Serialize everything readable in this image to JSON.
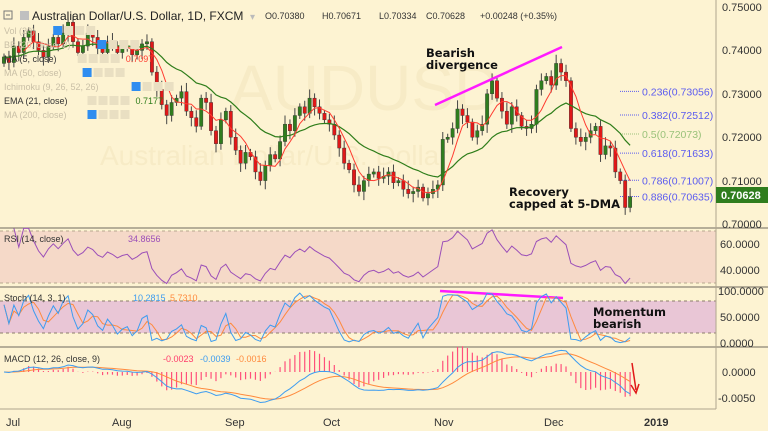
{
  "header": {
    "title": "Australian Dollar/U.S. Dollar, 1D, FXCM",
    "open": "O0.70380",
    "high": "H0.70671",
    "low": "L0.70334",
    "close": "C0.70628",
    "change": "+0.00248 (+0.35%)"
  },
  "watermark": {
    "symbol": "AUDUSD",
    "name": "Australian Dollar/U.S. Dollar"
  },
  "indicators": [
    {
      "label": "Vol (20)",
      "value": ""
    },
    {
      "label": "BB (20, close, 2)",
      "value": ""
    },
    {
      "label": "MA (5, close)",
      "value": "0.7097"
    },
    {
      "label": "MA (50, close)",
      "value": ""
    },
    {
      "label": "Ichimoku (9, 26, 52, 26)",
      "value": ""
    },
    {
      "label": "EMA (21, close)",
      "value": "0.7177"
    },
    {
      "label": "MA (200, close)",
      "value": ""
    }
  ],
  "annotations": {
    "bearish": [
      "Bearish",
      "divergence"
    ],
    "recovery": [
      "Recovery",
      "capped at 5-DMA"
    ],
    "momentum": [
      "Momentum",
      "bearish"
    ]
  },
  "fib_levels": [
    {
      "label": "0.236(0.73056)",
      "price": 0.73056,
      "color": "#5b5bf0"
    },
    {
      "label": "0.382(0.72512)",
      "price": 0.72512,
      "color": "#5b5bf0"
    },
    {
      "label": "0.5(0.72073)",
      "price": 0.72073,
      "color": "#9ac27a"
    },
    {
      "label": "0.618(0.71633)",
      "price": 0.71633,
      "color": "#5b5bf0"
    },
    {
      "label": "0.786(0.71007)",
      "price": 0.71007,
      "color": "#5b5bf0"
    },
    {
      "label": "0.886(0.70635)",
      "price": 0.70635,
      "color": "#5b5bf0"
    }
  ],
  "last_price": "0.70628",
  "panels": {
    "rsi": {
      "label": "RSI (14, close)",
      "value": "34.8656",
      "ticks": [
        "60.0000",
        "40.0000"
      ]
    },
    "stoch": {
      "label": "Stoch (14, 3, 1)",
      "k": "10.2815",
      "d": "5.7310",
      "ticks": [
        "100.0000",
        "50.0000",
        "0.0000"
      ]
    },
    "macd": {
      "label": "MACD (12, 26, close, 9)",
      "hist": "-0.0023",
      "macd": "-0.0039",
      "signal": "-0.0016",
      "ticks": [
        "0.0000",
        "-0.0050"
      ]
    }
  },
  "colors": {
    "bull": "#2f7d1e",
    "bear": "#e01818",
    "sma5": "#ff3b30",
    "ema21": "#2e7d1a",
    "rsi": "#9b4fb8",
    "k": "#3d9cf0",
    "d": "#ff8a3d",
    "hist": "#ff4f7b",
    "trend": "#ff1aff",
    "bg": "#fdf3d2"
  },
  "chart_data": {
    "type": "candlestick",
    "title": "Australian Dollar/U.S. Dollar, 1D, FXCM",
    "ylim": [
      0.7,
      0.75
    ],
    "yticks": [
      "0.75000",
      "0.74000",
      "0.73000",
      "0.72000",
      "0.71000",
      "0.70000"
    ],
    "xticks": [
      "Jul",
      "Aug",
      "Sep",
      "Oct",
      "Nov",
      "Dec",
      "2019"
    ],
    "first_open": 0.737,
    "closes": [
      0.7385,
      0.7372,
      0.741,
      0.7395,
      0.743,
      0.7445,
      0.742,
      0.74,
      0.7385,
      0.741,
      0.743,
      0.7415,
      0.744,
      0.7465,
      0.742,
      0.7395,
      0.741,
      0.744,
      0.743,
      0.7405,
      0.7395,
      0.742,
      0.741,
      0.7395,
      0.7405,
      0.741,
      0.739,
      0.74,
      0.7415,
      0.742,
      0.735,
      0.731,
      0.7275,
      0.725,
      0.728,
      0.729,
      0.7305,
      0.726,
      0.7245,
      0.7225,
      0.729,
      0.728,
      0.7215,
      0.7185,
      0.724,
      0.726,
      0.72,
      0.717,
      0.714,
      0.7165,
      0.7155,
      0.712,
      0.71,
      0.7135,
      0.716,
      0.715,
      0.719,
      0.723,
      0.7215,
      0.725,
      0.727,
      0.7255,
      0.729,
      0.727,
      0.7255,
      0.724,
      0.723,
      0.7205,
      0.7175,
      0.714,
      0.7125,
      0.709,
      0.7075,
      0.71,
      0.7115,
      0.712,
      0.7105,
      0.711,
      0.712,
      0.7095,
      0.71,
      0.708,
      0.707,
      0.7075,
      0.7085,
      0.706,
      0.707,
      0.708,
      0.709,
      0.7195,
      0.72,
      0.722,
      0.7265,
      0.725,
      0.7235,
      0.72,
      0.7215,
      0.723,
      0.73,
      0.733,
      0.729,
      0.726,
      0.723,
      0.727,
      0.725,
      0.7225,
      0.722,
      0.723,
      0.731,
      0.733,
      0.734,
      0.732,
      0.737,
      0.735,
      0.733,
      0.722,
      0.72,
      0.719,
      0.72,
      0.7215,
      0.7225,
      0.716,
      0.718,
      0.7175,
      0.712,
      0.71,
      0.7038,
      0.7063
    ]
  }
}
